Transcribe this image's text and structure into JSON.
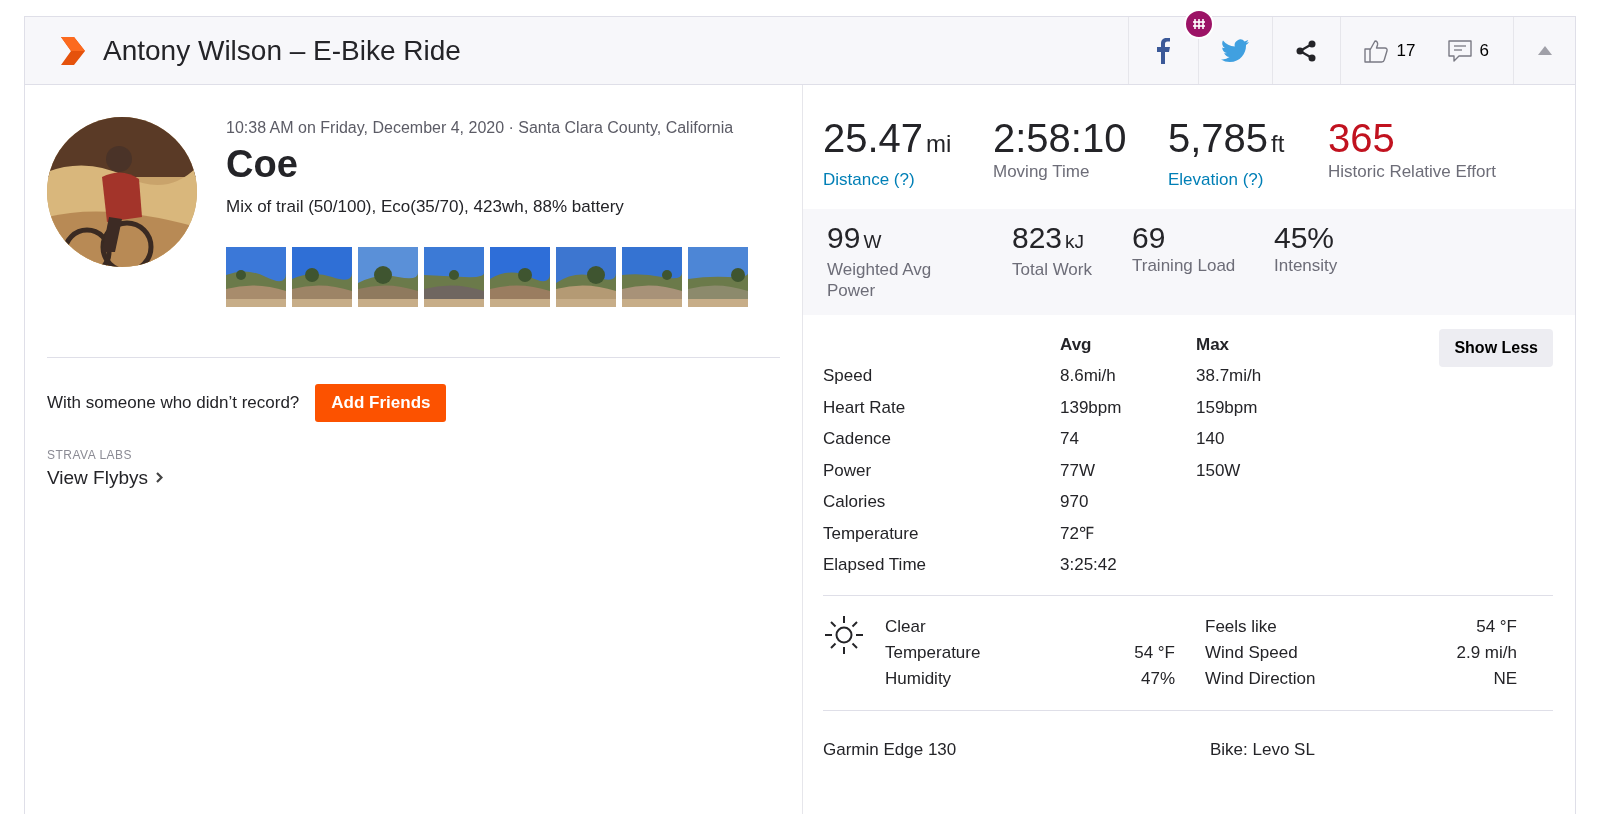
{
  "header": {
    "title": "Antony Wilson – E-Bike Ride",
    "kudos": "17",
    "comments": "6"
  },
  "activity": {
    "meta": "10:38 AM on Friday, December 4, 2020 · Santa Clara County, California",
    "name": "Coe",
    "description": "Mix of trail (50/100), Eco(35/70), 423wh, 88% battery"
  },
  "friends": {
    "prompt": "With someone who didn’t record?",
    "button": "Add Friends"
  },
  "labs": {
    "label": "STRAVA LABS",
    "link": "View Flybys"
  },
  "primary_stats": [
    {
      "value": "25.47",
      "unit": "mi",
      "label": "Distance (?)",
      "kind": "link"
    },
    {
      "value": "2:58:10",
      "label": "Moving Time",
      "kind": "plain"
    },
    {
      "value": "5,785",
      "unit": "ft",
      "label": "Elevation (?)",
      "kind": "link"
    },
    {
      "value": "365",
      "label": "Historic Relative Effort",
      "kind": "effort"
    }
  ],
  "secondary_stats": [
    {
      "value": "99",
      "unit": "W",
      "label": "Weighted Avg Power"
    },
    {
      "value": "823",
      "unit": "kJ",
      "label": "Total Work"
    },
    {
      "value": "69",
      "label": "Training Load"
    },
    {
      "value": "45%",
      "label": "Intensity"
    }
  ],
  "details": {
    "columns": [
      "Avg",
      "Max"
    ],
    "button": "Show Less",
    "rows": [
      {
        "name": "Speed",
        "avg": "8.6mi/h",
        "max": "38.7mi/h"
      },
      {
        "name": "Heart Rate",
        "avg": "139bpm",
        "max": "159bpm"
      },
      {
        "name": "Cadence",
        "avg": "74",
        "max": "140"
      },
      {
        "name": "Power",
        "avg": "77W",
        "max": "150W"
      },
      {
        "name": "Calories",
        "avg": "970"
      },
      {
        "name": "Temperature",
        "avg": "72℉"
      },
      {
        "name": "Elapsed Time",
        "avg": "3:25:42"
      }
    ]
  },
  "weather": {
    "condition": "Clear",
    "left": [
      {
        "label": "Temperature",
        "value": "54 °F"
      },
      {
        "label": "Humidity",
        "value": "47%"
      }
    ],
    "right": [
      {
        "label": "Feels like",
        "value": "54 °F"
      },
      {
        "label": "Wind Speed",
        "value": "2.9 mi/h"
      },
      {
        "label": "Wind Direction",
        "value": "NE"
      }
    ]
  },
  "device": "Garmin Edge 130",
  "bike": "Bike: Levo SL"
}
